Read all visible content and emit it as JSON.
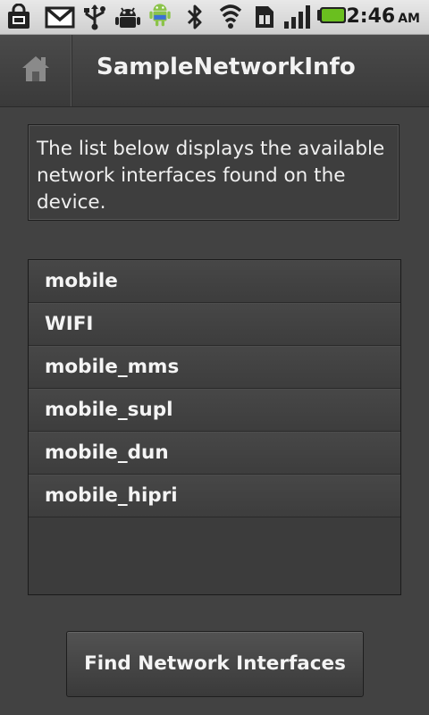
{
  "status_bar": {
    "time": "2:46",
    "ampm": "AM",
    "icons": [
      "shopping-bag-icon",
      "gmail-icon",
      "usb-icon",
      "android-debug-icon",
      "android-robot-icon",
      "bluetooth-icon",
      "wifi-icon",
      "sim-card-icon",
      "signal-strength-icon",
      "battery-icon"
    ],
    "battery_color": "#6abf1f"
  },
  "title_bar": {
    "title": "SampleNetworkInfo",
    "home_icon": "home-icon"
  },
  "description": "The list below displays the available network interfaces found on the device.",
  "interfaces": [
    {
      "label": "mobile"
    },
    {
      "label": "WIFI"
    },
    {
      "label": "mobile_mms"
    },
    {
      "label": "mobile_supl"
    },
    {
      "label": "mobile_dun"
    },
    {
      "label": "mobile_hipri"
    }
  ],
  "button": {
    "label": "Find Network Interfaces"
  }
}
